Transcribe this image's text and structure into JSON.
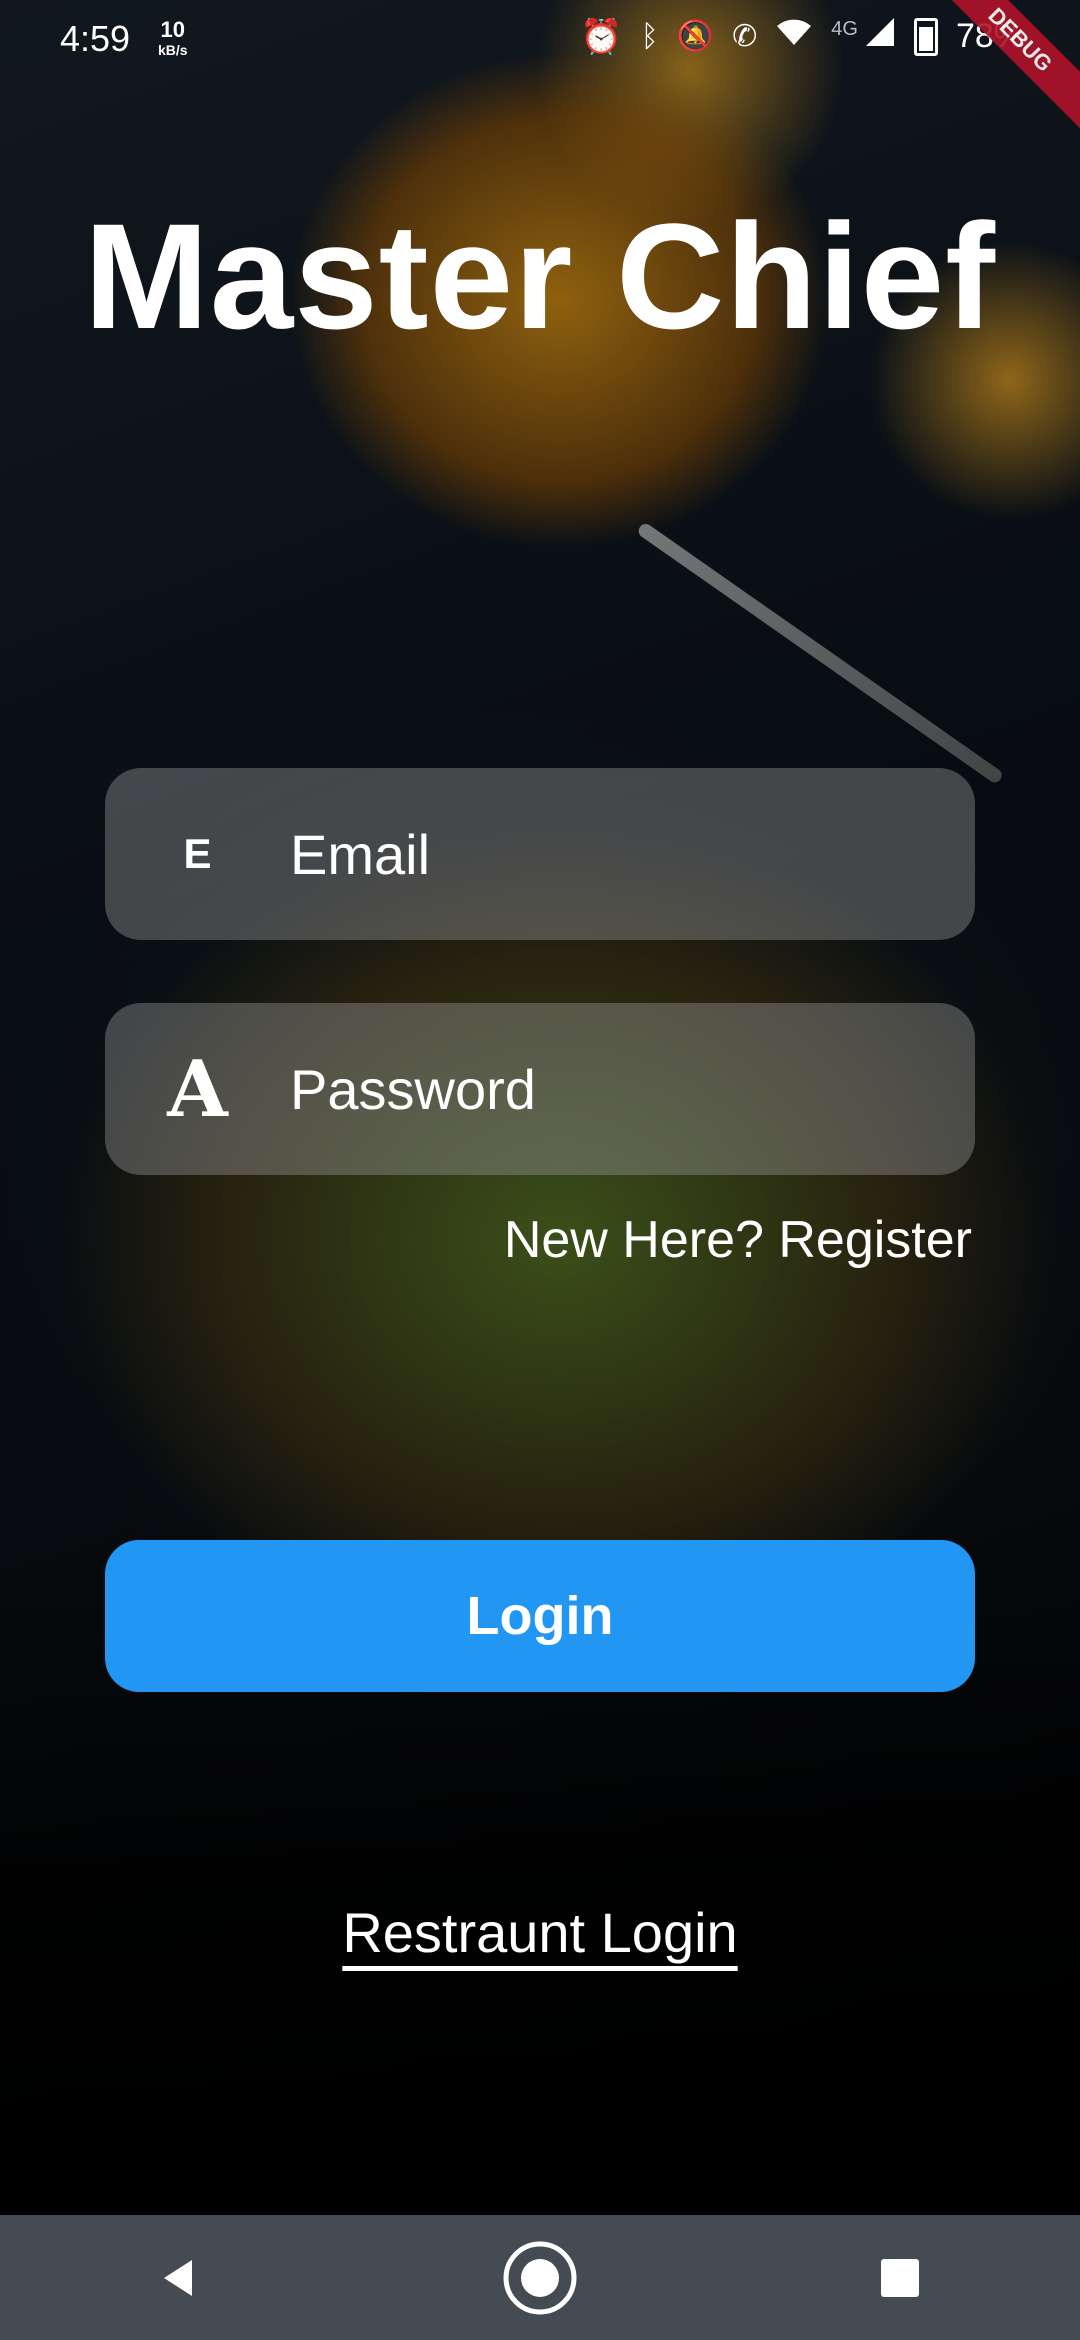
{
  "status_bar": {
    "time": "4:59",
    "net_speed_value": "10",
    "net_speed_unit": "kB/s",
    "network_type": "4G",
    "battery_percent": "78%"
  },
  "debug_banner": "DEBUG",
  "app": {
    "title": "Master Chief"
  },
  "login_form": {
    "email": {
      "lead_glyph": "E",
      "placeholder": "Email",
      "value": ""
    },
    "password": {
      "lead_glyph": "A",
      "placeholder": "Password",
      "value": ""
    },
    "register_link": "New Here? Register",
    "login_button": "Login",
    "restaurant_login": "Restraunt Login"
  },
  "colors": {
    "primary_button": "#2196f3",
    "nav_bar": "#454b53",
    "debug_banner": "#b0122a"
  },
  "nav_bar": {
    "icons": [
      "back-icon",
      "home-icon",
      "recents-icon"
    ]
  }
}
